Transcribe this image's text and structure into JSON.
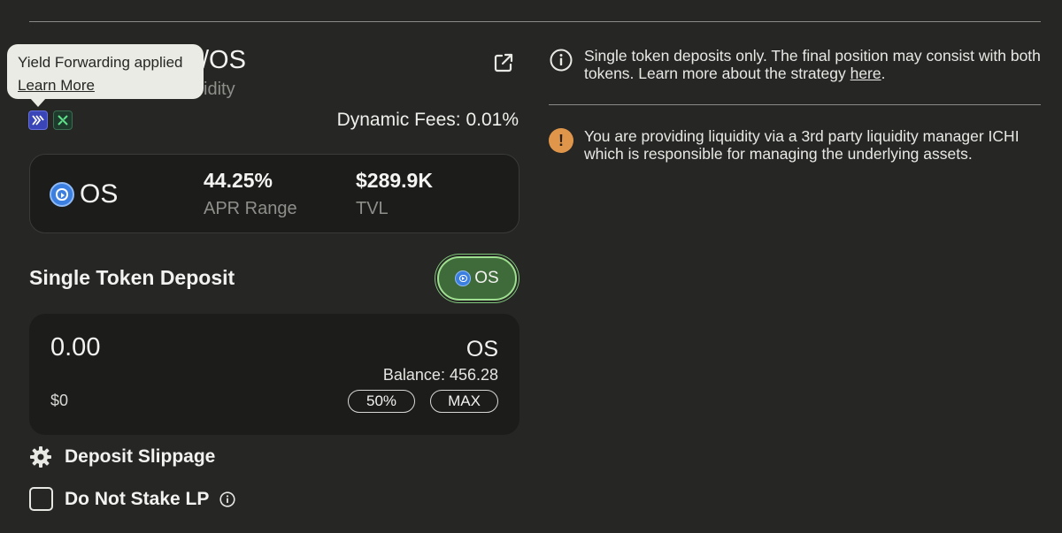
{
  "header": {
    "pool_title": "/OS",
    "pool_subtitle": "idity"
  },
  "tooltip": {
    "title": "Yield Forwarding applied",
    "link": "Learn More"
  },
  "badges": [
    {
      "icon": "yield-forwarding-icon",
      "glyph": "Y",
      "color": "#3a45b8"
    },
    {
      "icon": "dex-icon",
      "glyph": "✕",
      "color": "#1d3a2c"
    }
  ],
  "dynamic_fees": "Dynamic Fees: 0.01%",
  "stats": {
    "token": "OS",
    "apr_value": "44.25%",
    "apr_label": "APR Range",
    "tvl_value": "$289.9K",
    "tvl_label": "TVL"
  },
  "deposit": {
    "section_title": "Single Token Deposit",
    "selected_token": "OS",
    "amount_placeholder": "0.00",
    "usd_value": "$0",
    "token": "OS",
    "balance": "Balance: 456.28",
    "btn_half": "50%",
    "btn_max": "MAX"
  },
  "settings": {
    "slippage_label": "Deposit Slippage",
    "stake_label": "Do Not Stake LP"
  },
  "notices": {
    "single_token_text": "Single token deposits only. The final position may consist with both tokens. Learn more about the strategy ",
    "single_token_link": "here",
    "single_token_suffix": ".",
    "manager_text": "You are providing liquidity via a 3rd party liquidity manager ICHI which is responsible for managing the underlying assets."
  },
  "colors": {
    "background": "#262724",
    "card": "#1c1d1b",
    "accent_green": "#3f6a3a",
    "token_blue": "#3b7fe0",
    "warning": "#e0964a"
  }
}
